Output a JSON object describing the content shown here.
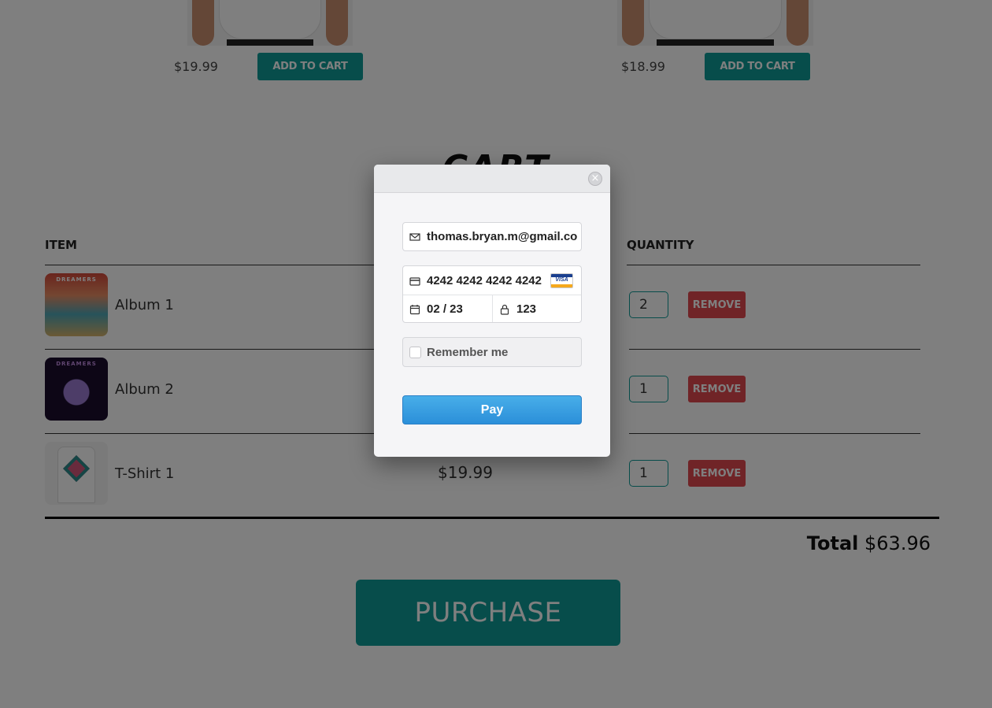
{
  "products": [
    {
      "price": "$19.99",
      "button_label": "ADD TO CART"
    },
    {
      "price": "$18.99",
      "button_label": "ADD TO CART"
    }
  ],
  "cart": {
    "title": "CART",
    "columns": {
      "item": "ITEM",
      "quantity": "QUANTITY"
    },
    "rows": [
      {
        "thumb_text": "DREAMERS",
        "name": "Album 1",
        "price": "",
        "quantity": "2",
        "remove_label": "REMOVE"
      },
      {
        "thumb_text": "DREAMERS",
        "name": "Album 2",
        "price": "",
        "quantity": "1",
        "remove_label": "REMOVE"
      },
      {
        "thumb_text": "",
        "name": "T-Shirt 1",
        "price": "$19.99",
        "quantity": "1",
        "remove_label": "REMOVE"
      }
    ],
    "total_label": "Total",
    "total_value": "$63.96",
    "purchase_label": "PURCHASE"
  },
  "checkout_modal": {
    "email": "thomas.bryan.m@gmail.co",
    "card_number": "4242 4242 4242 4242",
    "card_brand": "VISA",
    "expiry": "02 / 23",
    "cvc": "123",
    "remember_label": "Remember me",
    "pay_label": "Pay"
  },
  "colors": {
    "teal_button": "#0e9a96",
    "remove_red": "#e0484f",
    "pay_blue": "#2b8fd9",
    "overlay": "rgba(0,0,0,0.5)"
  }
}
